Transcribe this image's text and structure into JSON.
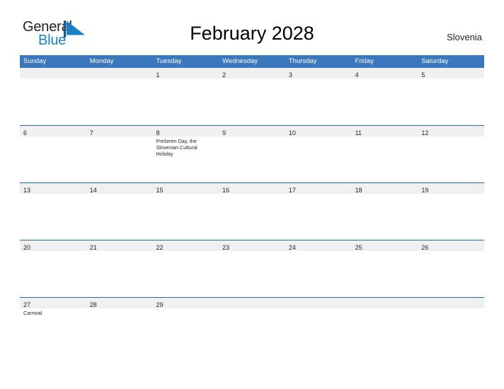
{
  "brand": {
    "name_part1": "General",
    "name_part2": "Blue",
    "flag_icon": "triangle-flag-icon",
    "flag_color": "#1b7fc4"
  },
  "header": {
    "title": "February 2028",
    "country": "Slovenia"
  },
  "theme": {
    "header_blue": "#3b77bc",
    "row_rule_blue": "#2b6ca3",
    "date_band_gray": "#f0f0f0",
    "text_dark": "#231f20"
  },
  "calendar": {
    "day_headers": [
      "Sunday",
      "Monday",
      "Tuesday",
      "Wednesday",
      "Thursday",
      "Friday",
      "Saturday"
    ],
    "weeks": [
      {
        "days": [
          {
            "num": "",
            "events": []
          },
          {
            "num": "",
            "events": []
          },
          {
            "num": "1",
            "events": []
          },
          {
            "num": "2",
            "events": []
          },
          {
            "num": "3",
            "events": []
          },
          {
            "num": "4",
            "events": []
          },
          {
            "num": "5",
            "events": []
          }
        ]
      },
      {
        "days": [
          {
            "num": "6",
            "events": []
          },
          {
            "num": "7",
            "events": []
          },
          {
            "num": "8",
            "events": [
              "Prešeren Day, the Slovenian Cultural Holiday"
            ]
          },
          {
            "num": "9",
            "events": []
          },
          {
            "num": "10",
            "events": []
          },
          {
            "num": "11",
            "events": []
          },
          {
            "num": "12",
            "events": []
          }
        ]
      },
      {
        "days": [
          {
            "num": "13",
            "events": []
          },
          {
            "num": "14",
            "events": []
          },
          {
            "num": "15",
            "events": []
          },
          {
            "num": "16",
            "events": []
          },
          {
            "num": "17",
            "events": []
          },
          {
            "num": "18",
            "events": []
          },
          {
            "num": "19",
            "events": []
          }
        ]
      },
      {
        "days": [
          {
            "num": "20",
            "events": []
          },
          {
            "num": "21",
            "events": []
          },
          {
            "num": "22",
            "events": []
          },
          {
            "num": "23",
            "events": []
          },
          {
            "num": "24",
            "events": []
          },
          {
            "num": "25",
            "events": []
          },
          {
            "num": "26",
            "events": []
          }
        ]
      },
      {
        "days": [
          {
            "num": "27",
            "events": [
              "Carnival"
            ]
          },
          {
            "num": "28",
            "events": []
          },
          {
            "num": "29",
            "events": []
          },
          {
            "num": "",
            "events": []
          },
          {
            "num": "",
            "events": []
          },
          {
            "num": "",
            "events": []
          },
          {
            "num": "",
            "events": []
          }
        ]
      }
    ]
  }
}
